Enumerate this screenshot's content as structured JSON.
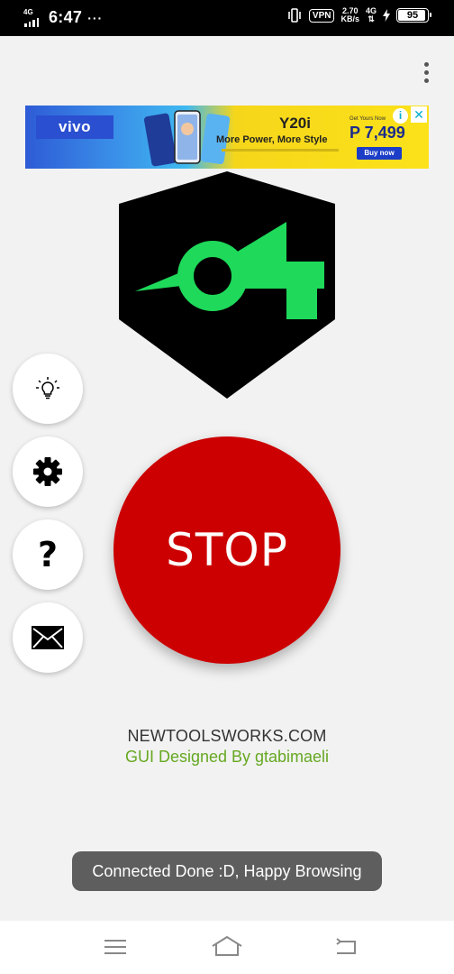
{
  "status_bar": {
    "network_type": "4G",
    "time": "6:47",
    "more": "···",
    "vpn": "VPN",
    "speed_value": "2.70",
    "speed_unit": "KB/s",
    "network_type_2": "4G",
    "battery": "95"
  },
  "ad": {
    "brand": "vivo",
    "model": "Y20i",
    "tagline": "More Power, More Style",
    "get_yours": "Get Yours Now",
    "price": "P 7,499",
    "cta": "Buy now",
    "info": "i",
    "close": "✕"
  },
  "app": {
    "stop_label": "STOP",
    "site": "NEWTOOLSWORKS.COM",
    "credit": "GUI  Designed By gtabimaeli",
    "help_symbol": "?",
    "logo_colors": {
      "background": "#000000",
      "mark": "#1ed95a"
    },
    "stop_color": "#cc0000"
  },
  "toast": {
    "message": "Connected Done :D, Happy Browsing"
  }
}
